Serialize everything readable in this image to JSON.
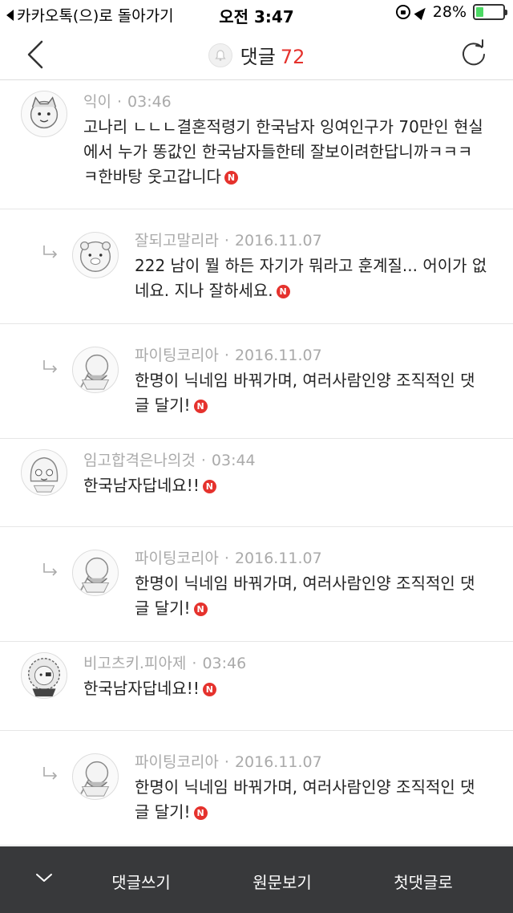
{
  "status_bar": {
    "back_app": "카카오톡(으)로 돌아가기",
    "time": "오전 3:47",
    "battery_text": "28%",
    "battery_level": 0.28,
    "battery_color": "#4cd964"
  },
  "header": {
    "title": "댓글",
    "count": "72",
    "count_color": "#e5322d"
  },
  "comments": [
    {
      "author": "익이",
      "time": "03:46",
      "lines": [
        "고나리 ㄴㄴㄴ결혼적령기 한국남자 잉여인구가 70만인 현실",
        "에서 누가 똥값인 한국남자들한테 잘보이려한답니까ㅋㅋㅋ",
        "ㅋ한바탕 웃고갑니다"
      ],
      "badge": "N",
      "reply": false
    },
    {
      "author": "잘되고말리라",
      "time": "2016.11.07",
      "lines": [
        "222 남이 뭘 하든 자기가 뭐라고 훈계질... 어이가 없",
        "네요. 지나 잘하세요."
      ],
      "badge": "N",
      "reply": true
    },
    {
      "author": "파이팅코리아",
      "time": "2016.11.07",
      "lines": [
        "한명이 닉네임 바꿔가며, 여러사람인양 조직적인 댓",
        "글 달기!"
      ],
      "badge": "N",
      "reply": true
    },
    {
      "author": "임고합격은나의것",
      "time": "03:44",
      "lines": [
        "한국남자답네요!!"
      ],
      "badge": "N",
      "reply": false
    },
    {
      "author": "파이팅코리아",
      "time": "2016.11.07",
      "lines": [
        "한명이 닉네임 바꿔가며, 여러사람인양 조직적인 댓",
        "글 달기!"
      ],
      "badge": "N",
      "reply": true
    },
    {
      "author": "비고츠키.피아제",
      "time": "03:46",
      "lines": [
        "한국남자답네요!!"
      ],
      "badge": "N",
      "reply": false
    },
    {
      "author": "파이팅코리아",
      "time": "2016.11.07",
      "lines": [
        "한명이 닉네임 바꿔가며, 여러사람인양 조직적인 댓",
        "글 달기!"
      ],
      "badge": "N",
      "reply": true
    }
  ],
  "bottom_bar": {
    "write_comment": "댓글쓰기",
    "view_original": "원문보기",
    "first_comment": "첫댓글로"
  },
  "icons": [
    "back-chevron-icon",
    "bell-icon",
    "refresh-icon",
    "reply-arrow-icon",
    "new-badge-icon",
    "chevron-down-icon"
  ]
}
